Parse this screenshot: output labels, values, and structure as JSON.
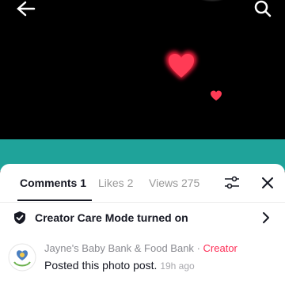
{
  "video": {
    "icons": [
      "back-arrow-icon",
      "search-icon",
      "heart-icon"
    ]
  },
  "comments_panel": {
    "tabs": [
      {
        "label": "Comments 1"
      },
      {
        "label": "Likes 2"
      },
      {
        "label": "Views 275"
      }
    ],
    "creator_care": {
      "label": "Creator Care Mode turned on"
    },
    "comment": {
      "author": "Jayne's Baby Bank & Food Bank",
      "separator": "·",
      "badge": "Creator",
      "text": "Posted this photo post.",
      "time": "19h ago"
    }
  },
  "colors": {
    "accent": "#fe2c55",
    "teal": "#1fa39a",
    "heart": "#ff2b4a"
  }
}
